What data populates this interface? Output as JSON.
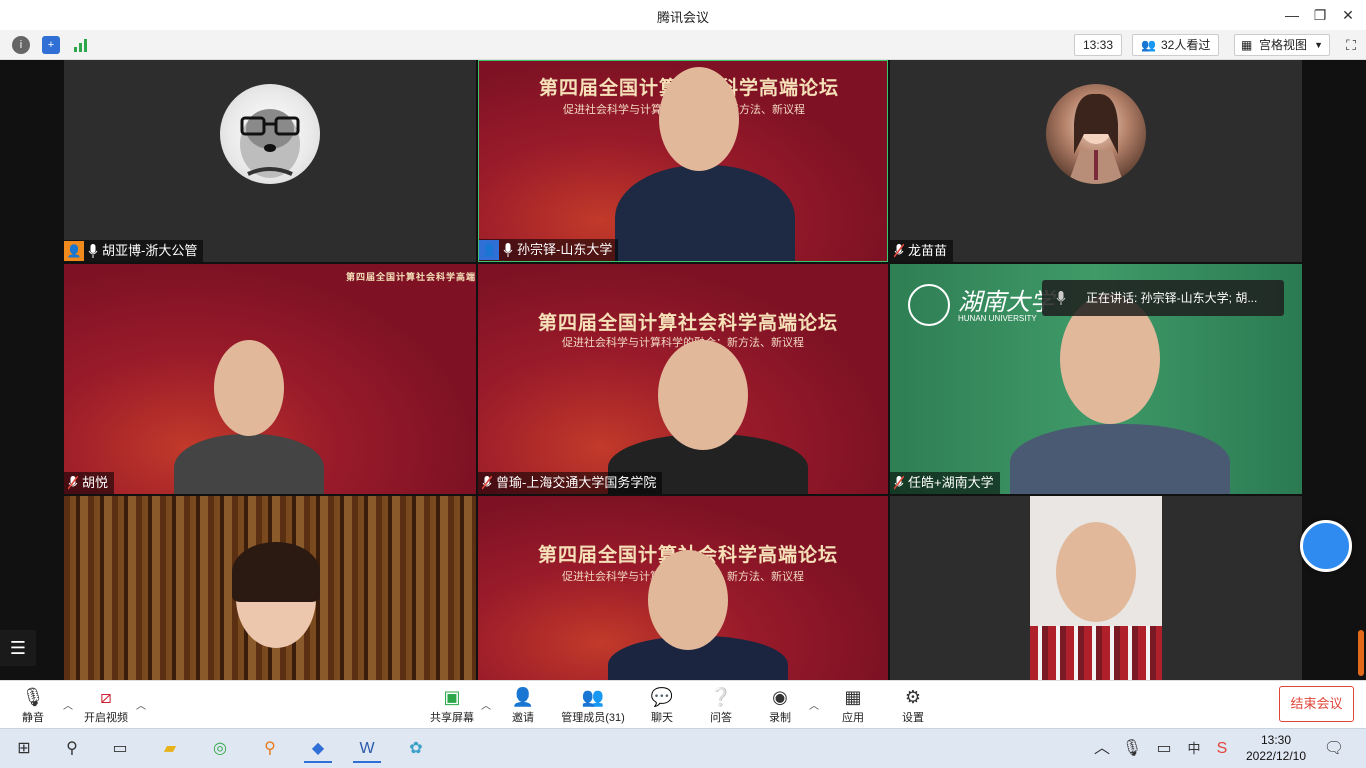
{
  "window": {
    "title": "腾讯会议"
  },
  "toolbar": {
    "time": "13:33",
    "viewers": "32人看过",
    "view_mode": "宫格视图"
  },
  "participants": [
    {
      "name": "胡亚博-浙大公管"
    },
    {
      "name": "孙宗铎-山东大学"
    },
    {
      "name": "龙苗苗"
    },
    {
      "name": "胡悦"
    },
    {
      "name": "曾瑜-上海交通大学国务学院"
    },
    {
      "name": "任皓+湖南大学"
    }
  ],
  "banner": {
    "title": "第四届全国计算社会科学高端论坛",
    "subtitle": "促进社会科学与计算科学的融合：新方法、新议程"
  },
  "hunan": {
    "logo_text": "湖南大学",
    "logo_en": "HUNAN UNIVERSITY"
  },
  "speaking": "正在讲话: 孙宗铎-山东大学; 胡...",
  "controls": {
    "mute": "静音",
    "video": "开启视频",
    "share": "共享屏幕",
    "invite": "邀请",
    "members": "管理成员(31)",
    "chat": "聊天",
    "qa": "问答",
    "record": "录制",
    "apps": "应用",
    "settings": "设置",
    "end": "结束会议"
  },
  "taskbar": {
    "ime": "中",
    "time": "13:30",
    "date": "2022/12/10"
  },
  "colors": {
    "accent": "#2f8bf0",
    "end": "#e0453a",
    "banner_red": "#9a1b2a"
  }
}
